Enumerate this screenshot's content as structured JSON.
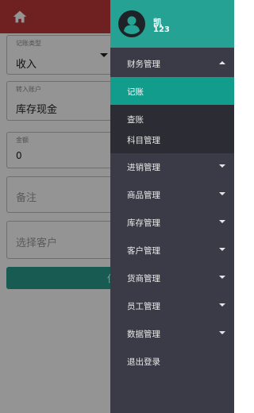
{
  "form": {
    "type_label": "记账类型",
    "type_value": "收入",
    "account_label": "转入账户",
    "account_value": "库存现金",
    "amount_label": "金额",
    "amount_value": "0",
    "remark_placeholder": "备注",
    "customer_placeholder": "选择客户",
    "submit_label": "保"
  },
  "user": {
    "name": "凯",
    "id": "123"
  },
  "menu": {
    "finance": {
      "label": "财务管理",
      "expanded": true,
      "children": [
        "记账",
        "查账",
        "科目管理"
      ],
      "active_child": "记账"
    },
    "items": [
      "进销管理",
      "商品管理",
      "库存管理",
      "客户管理",
      "货商管理",
      "员工管理",
      "数据管理"
    ],
    "logout": "退出登录"
  },
  "colors": {
    "header_red": "#c0393b",
    "drawer_header": "#25a293",
    "drawer_bg": "#3b3b47",
    "active_item": "#129c8c",
    "submenu_bg": "#2b2c34"
  }
}
